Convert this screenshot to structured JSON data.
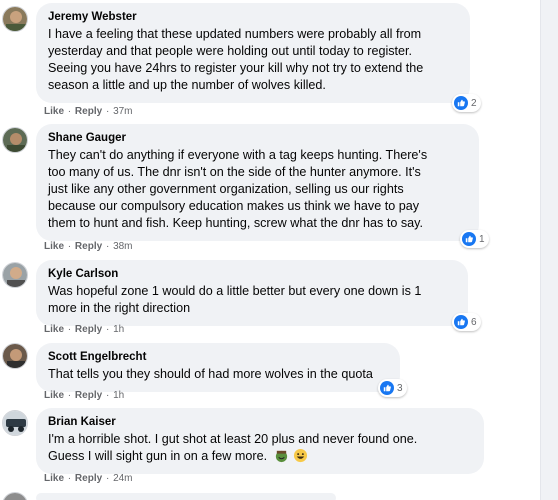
{
  "comments": [
    {
      "author": "Jeremy Webster",
      "lines": [
        "I have a feeling that these updated numbers were probably all from",
        "yesterday and that people were holding out until today to register.",
        "Seeing you have 24hrs to register your kill why not try to extend the",
        "season a little and up the number of wolves killed."
      ],
      "like": "Like",
      "reply": "Reply",
      "time": "37m",
      "reactions": "2"
    },
    {
      "author": "Shane Gauger",
      "lines": [
        "They can't do anything if everyone with a tag keeps hunting. There's",
        "too many of us. The dnr isn't on the side of the hunter anymore. It's",
        "just like any other government organization, selling us our rights",
        "because our compulsory education makes us think we have to pay",
        "them to hunt and fish. Keep hunting, screw what the dnr has to say."
      ],
      "like": "Like",
      "reply": "Reply",
      "time": "38m",
      "reactions": "1"
    },
    {
      "author": "Kyle Carlson",
      "lines": [
        "Was hopeful zone 1 would do a little better but every one down is 1",
        "more in the right direction"
      ],
      "like": "Like",
      "reply": "Reply",
      "time": "1h",
      "reactions": "6"
    },
    {
      "author": "Scott Engelbrecht",
      "lines": [
        "That tells you they should of had more wolves in the quota"
      ],
      "like": "Like",
      "reply": "Reply",
      "time": "1h",
      "reactions": "3"
    },
    {
      "author": "Brian Kaiser",
      "lines": [
        "I'm a horrible shot. I gut shot at least 20 plus and never found one.",
        "Guess I will sight gun in on a few more."
      ],
      "like": "Like",
      "reply": "Reply",
      "time": "24m",
      "reactions": ""
    }
  ],
  "separator": "·",
  "icons": {
    "like_reaction": "thumbs-up-icon",
    "emoji_1": "laughing-face-icon",
    "emoji_2": "grinning-face-icon"
  },
  "colors": {
    "bubble": "#f0f2f5",
    "like_blue": "#1877f2",
    "meta_text": "#65676b"
  }
}
